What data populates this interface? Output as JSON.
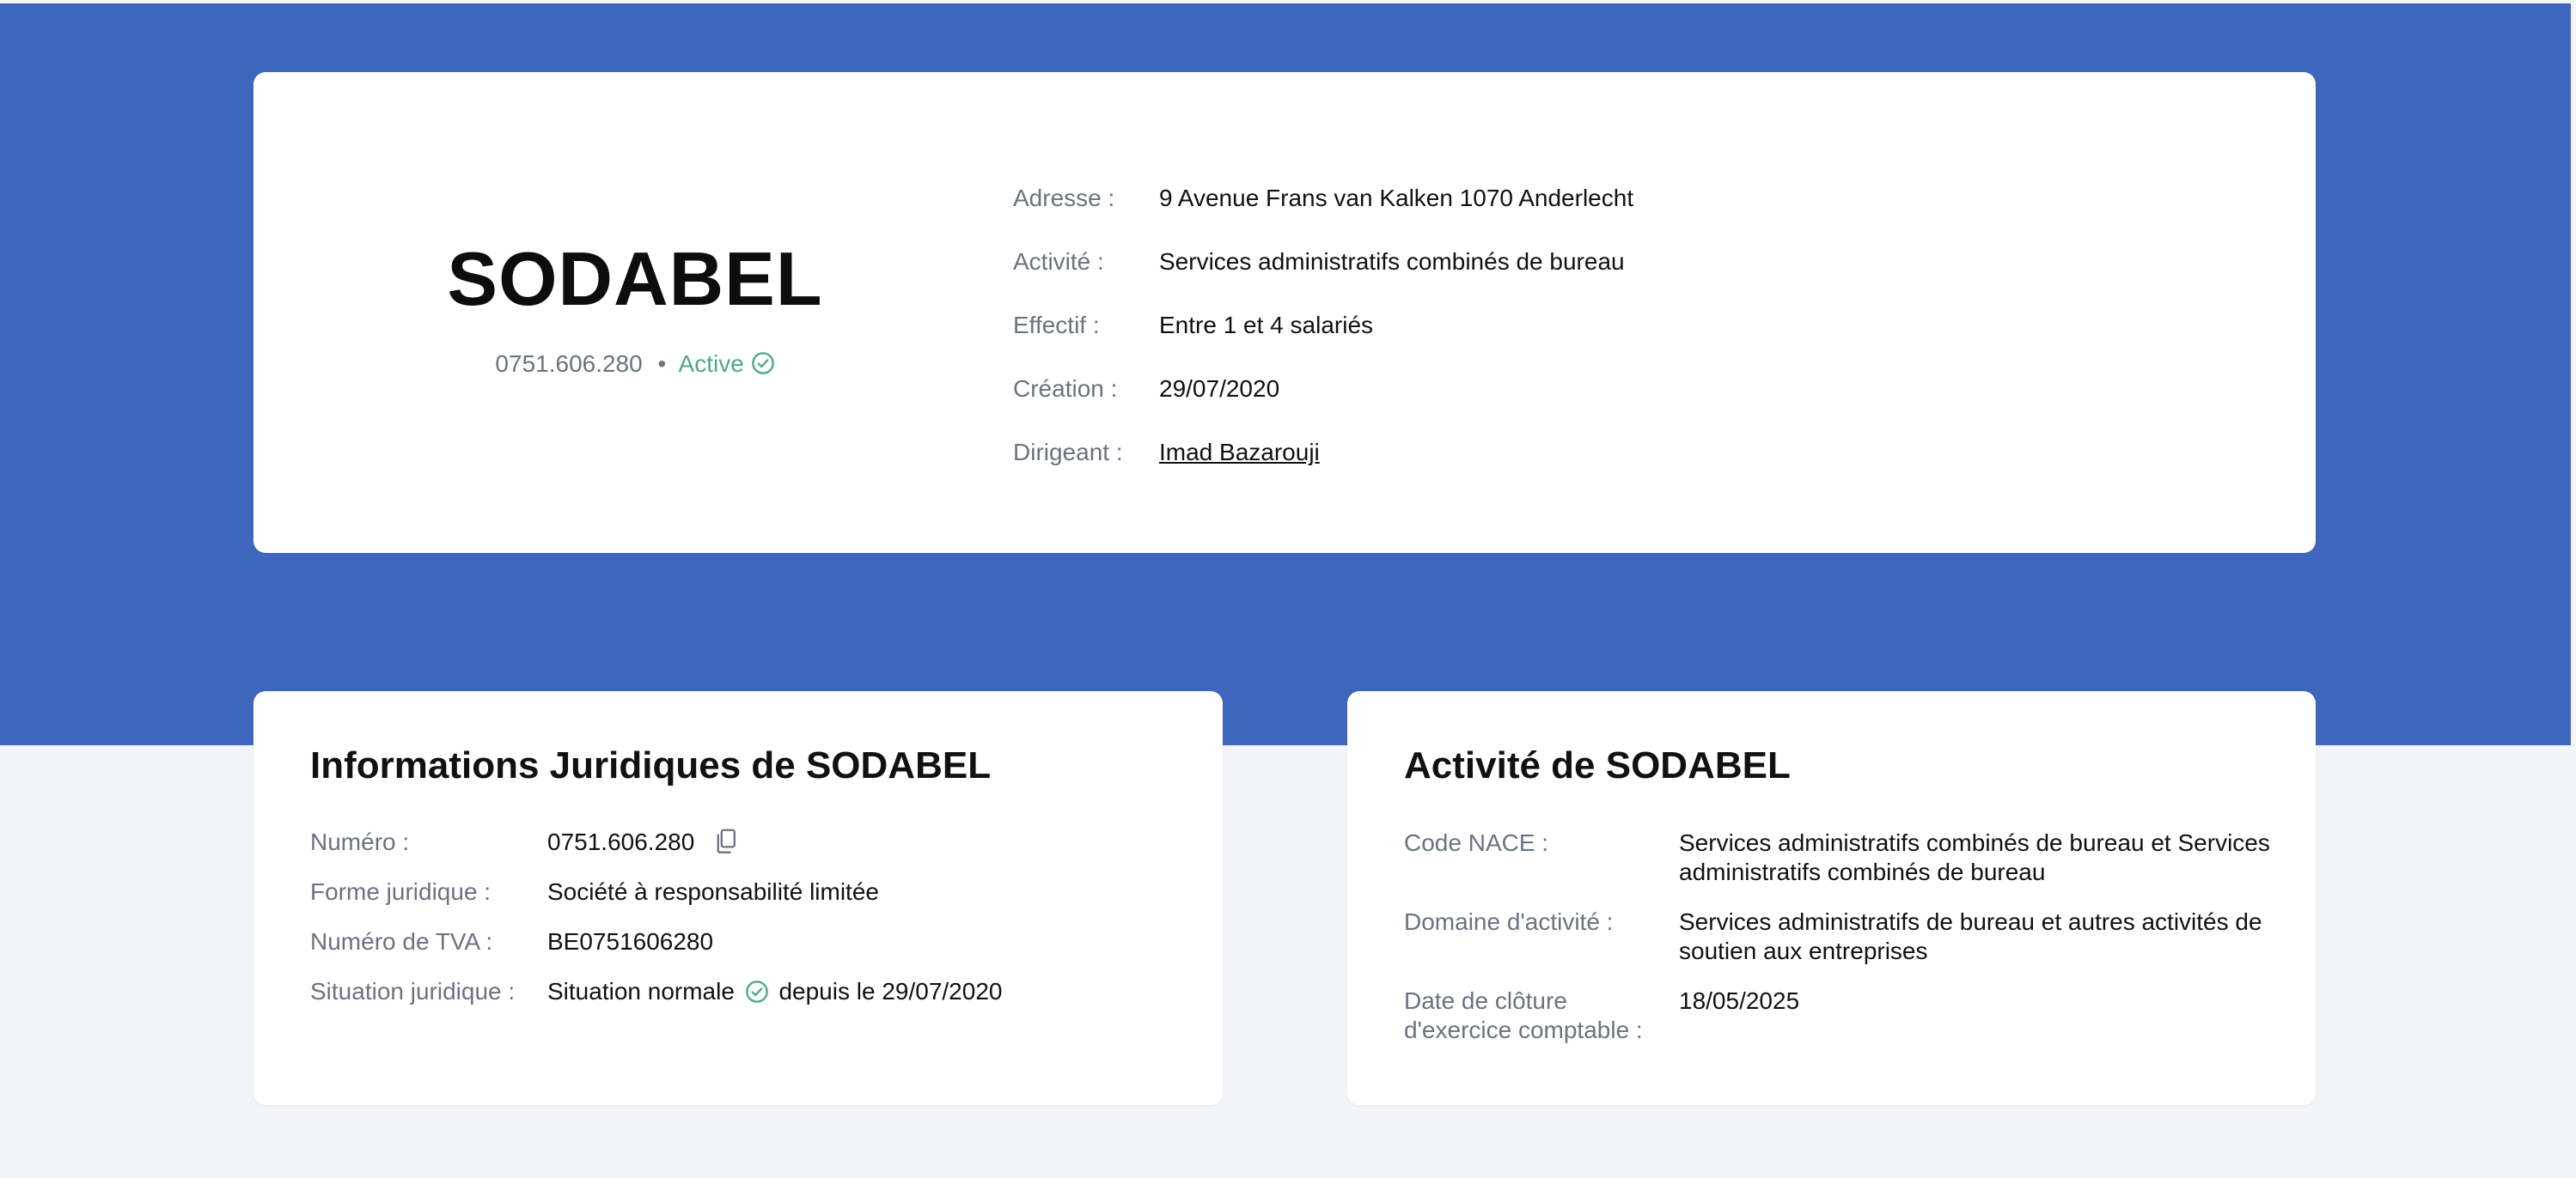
{
  "header": {
    "company_name": "SODABEL",
    "company_number": "0751.606.280",
    "separator": "•",
    "status": "Active",
    "details": [
      {
        "label": "Adresse :",
        "value": "9 Avenue Frans van Kalken 1070 Anderlecht"
      },
      {
        "label": "Activité :",
        "value": "Services administratifs combinés de bureau"
      },
      {
        "label": "Effectif :",
        "value": "Entre 1 et 4 salariés"
      },
      {
        "label": "Création :",
        "value": "29/07/2020"
      },
      {
        "label": "Dirigeant :",
        "value": "Imad Bazarouji"
      }
    ]
  },
  "legal": {
    "title": "Informations Juridiques de SODABEL",
    "rows": [
      {
        "label": "Numéro :",
        "value": "0751.606.280"
      },
      {
        "label": "Forme juridique :",
        "value": "Société à responsabilité limitée"
      },
      {
        "label": "Numéro de TVA :",
        "value": "BE0751606280"
      },
      {
        "label": "Situation juridique :",
        "value": "Situation normale",
        "value_suffix": "depuis le 29/07/2020"
      }
    ]
  },
  "activity": {
    "title": "Activité de SODABEL",
    "rows": [
      {
        "label": "Code NACE :",
        "value": "Services administratifs combinés de bureau et Services administratifs combinés de bureau"
      },
      {
        "label": "Domaine d'activité :",
        "value": "Services administratifs de bureau et autres activités de soutien aux entreprises"
      },
      {
        "label": "Date de clôture d'exercice comptable :",
        "value": "18/05/2025"
      }
    ]
  },
  "colors": {
    "band": "#3f66bd",
    "active_green": "#4fa88a",
    "label_gray": "#6b7280"
  },
  "icons": {
    "status": "check-circle-icon",
    "copy": "copy-icon"
  }
}
